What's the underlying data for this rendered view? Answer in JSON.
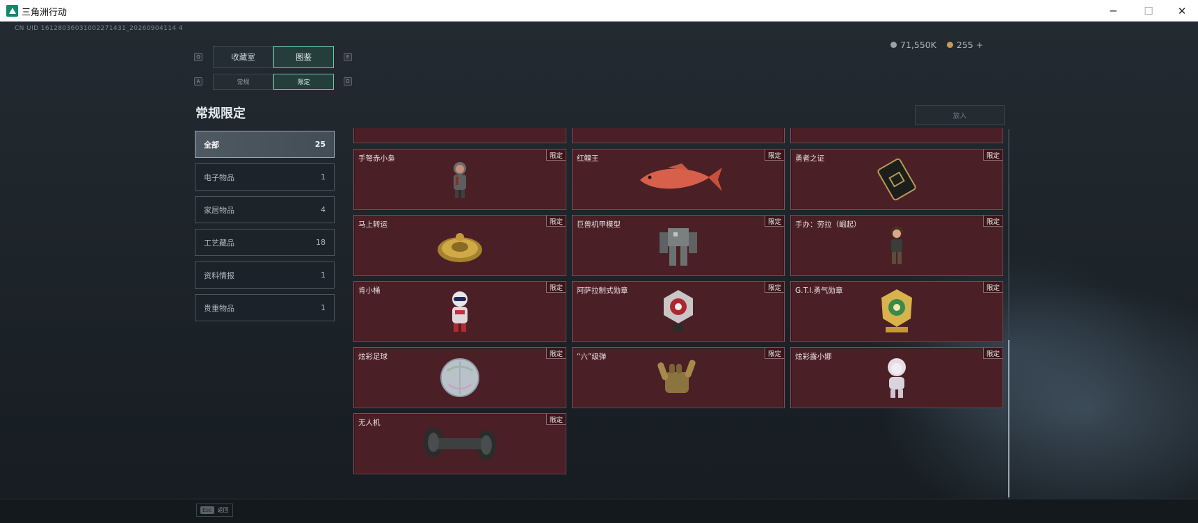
{
  "window": {
    "title": "三角洲行动",
    "minimize": "─",
    "maximize": "☐",
    "close": "✕"
  },
  "hud": {
    "uid": "CN UID 16128036031002271431_20260904114 4",
    "currency": [
      {
        "icon": "silver-coin-icon",
        "value": "71,550K"
      },
      {
        "icon": "gold-coin-icon",
        "value": "255 +"
      }
    ]
  },
  "tabs": {
    "main": [
      {
        "label": "收藏室",
        "key": "Q"
      },
      {
        "label": "图鉴",
        "key": "E",
        "active": true
      }
    ],
    "sub": [
      {
        "label": "常规",
        "key": "A"
      },
      {
        "label": "限定",
        "key": "D",
        "active": true
      }
    ]
  },
  "page_title": "常规限定",
  "categories": [
    {
      "label": "全部",
      "count": "25",
      "active": true
    },
    {
      "label": "电子物品",
      "count": "1"
    },
    {
      "label": "家居物品",
      "count": "4"
    },
    {
      "label": "工艺藏品",
      "count": "18"
    },
    {
      "label": "资料情报",
      "count": "1"
    },
    {
      "label": "贵重物品",
      "count": "1"
    }
  ],
  "put_button": "放入",
  "items": [
    {
      "name": "手弩赤小枭",
      "tag": "限定",
      "icon": "figure-hooded-icon"
    },
    {
      "name": "红鲤王",
      "tag": "限定",
      "icon": "fish-icon"
    },
    {
      "name": "勇者之证",
      "tag": "限定",
      "icon": "card-icon"
    },
    {
      "name": "马上转运",
      "tag": "限定",
      "icon": "golden-disc-icon"
    },
    {
      "name": "巨兽机甲模型",
      "tag": "限定",
      "icon": "mech-icon"
    },
    {
      "name": "手办：劳拉（崛起）",
      "tag": "限定",
      "icon": "figure-lara-icon"
    },
    {
      "name": "肯小桶",
      "tag": "限定",
      "icon": "figure-bucket-icon"
    },
    {
      "name": "阿萨拉制式勋章",
      "tag": "限定",
      "icon": "medal-red-icon"
    },
    {
      "name": "G.T.I.勇气勋章",
      "tag": "限定",
      "icon": "medal-gold-icon"
    },
    {
      "name": "炫彩足球",
      "tag": "限定",
      "icon": "football-icon"
    },
    {
      "name": "“六”级弹",
      "tag": "限定",
      "icon": "hand-icon"
    },
    {
      "name": "炫彩露小娜",
      "tag": "限定",
      "icon": "figure-white-icon"
    },
    {
      "name": "无人机",
      "tag": "限定",
      "icon": "drone-icon"
    }
  ],
  "footer": {
    "key": "Esc",
    "label": "返回"
  }
}
